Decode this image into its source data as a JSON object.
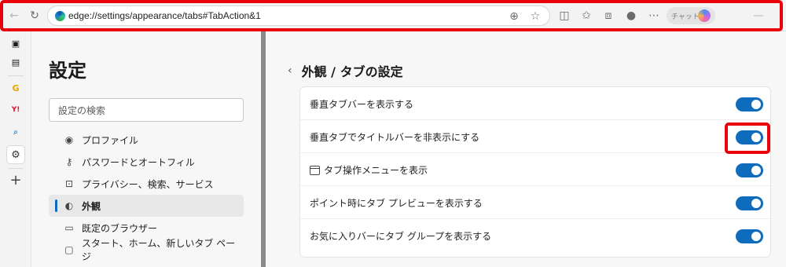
{
  "toolbar": {
    "url": "edge://settings/appearance/tabs#TabAction&1",
    "chat_label": "チャット"
  },
  "rail": {
    "items": [
      {
        "name": "tab-actions-icon",
        "glyph": "▣"
      },
      {
        "name": "workspaces-icon",
        "glyph": "▤"
      },
      {
        "name": "google-icon",
        "glyph": "G"
      },
      {
        "name": "yahoo-icon",
        "glyph": "Y!"
      },
      {
        "name": "search-tab-icon",
        "glyph": "🔍"
      },
      {
        "name": "settings-tab-icon",
        "glyph": "⚙"
      },
      {
        "name": "new-tab-icon",
        "glyph": "+"
      }
    ]
  },
  "sidebar": {
    "title": "設定",
    "search_placeholder": "設定の検索",
    "items": [
      {
        "label": "プロファイル",
        "icon": "profile-icon",
        "glyph": "◉"
      },
      {
        "label": "パスワードとオートフィル",
        "icon": "key-icon",
        "glyph": "⚷"
      },
      {
        "label": "プライバシー、検索、サービス",
        "icon": "lock-icon",
        "glyph": "🔒"
      },
      {
        "label": "外観",
        "icon": "palette-icon",
        "glyph": "◐"
      },
      {
        "label": "既定のブラウザー",
        "icon": "browser-icon",
        "glyph": "▭"
      },
      {
        "label": "スタート、ホーム、新しいタブ ページ",
        "icon": "home-page-icon",
        "glyph": "▢"
      }
    ],
    "selected_index": 3
  },
  "main": {
    "title": "外観 / タブの設定",
    "settings": [
      {
        "label": "垂直タブバーを表示する",
        "on": true
      },
      {
        "label": "垂直タブでタイトルバーを非表示にする",
        "on": true
      },
      {
        "label": "タブ操作メニューを表示",
        "on": true,
        "icon": "tab-menu-icon"
      },
      {
        "label": "ポイント時にタブ プレビューを表示する",
        "on": true
      },
      {
        "label": "お気に入りバーにタブ グループを表示する",
        "on": true
      }
    ]
  },
  "colors": {
    "accent": "#0f6cbd",
    "highlight": "#e8000b"
  }
}
